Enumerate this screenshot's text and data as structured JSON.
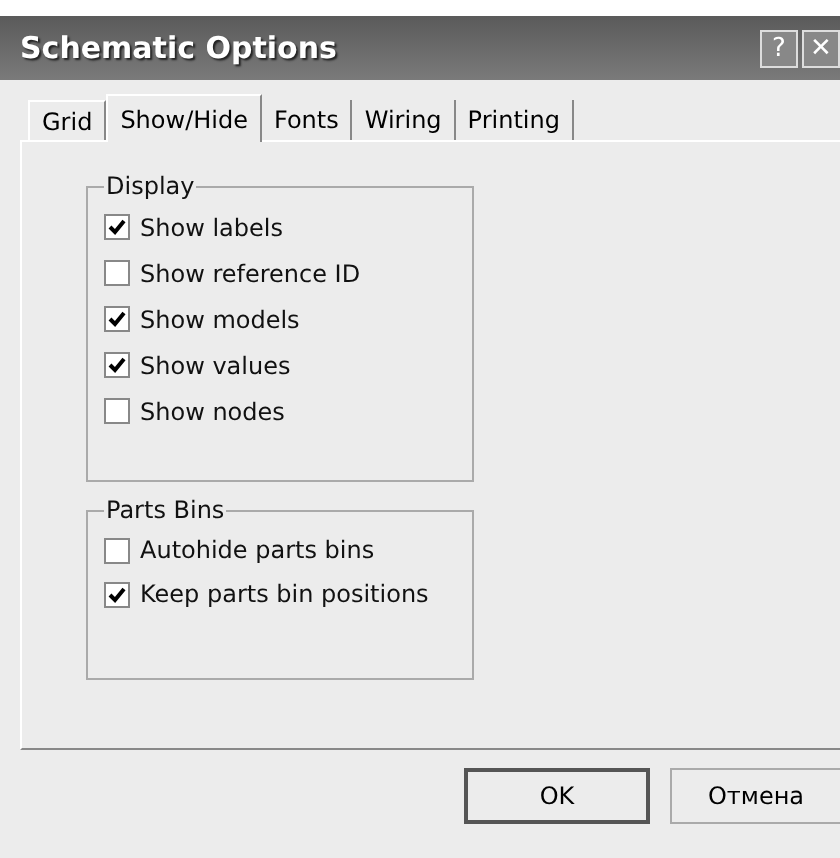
{
  "window": {
    "title": "Schematic Options",
    "title_buttons": [
      "?",
      "✕"
    ]
  },
  "tabs": [
    {
      "label": "Grid",
      "selected": false
    },
    {
      "label": "Show/Hide",
      "selected": true
    },
    {
      "label": "Fonts",
      "selected": false
    },
    {
      "label": "Wiring",
      "selected": false
    },
    {
      "label": "Printing",
      "selected": false
    }
  ],
  "groups": [
    {
      "title": "Display",
      "options": [
        {
          "label": "Show labels",
          "checked": true
        },
        {
          "label": "Show reference ID",
          "checked": false
        },
        {
          "label": "Show models",
          "checked": true
        },
        {
          "label": "Show values",
          "checked": true
        },
        {
          "label": "Show nodes",
          "checked": false
        }
      ]
    },
    {
      "title": "Parts Bins",
      "options": [
        {
          "label": "Autohide parts bins",
          "checked": false
        },
        {
          "label": "Keep parts bin positions",
          "checked": true
        }
      ]
    }
  ],
  "buttons": [
    {
      "label": "OK",
      "default": true
    },
    {
      "label": "Отмена",
      "default": false
    }
  ]
}
